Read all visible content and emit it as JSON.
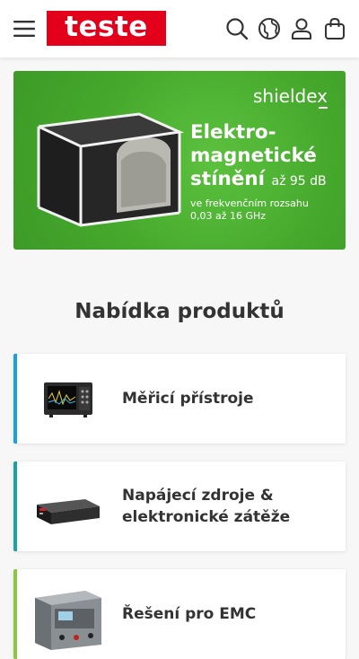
{
  "header": {
    "logo_text": "teste",
    "icons": [
      "menu-icon",
      "search-icon",
      "globe-icon",
      "user-icon",
      "shopping-bag-icon"
    ]
  },
  "banner": {
    "brand": "shieldex",
    "headline_line1": "Elektro-",
    "headline_line2": "magnetické",
    "headline_line3": "stínění",
    "headline_suffix": "až 95 dB",
    "sub_line1": "ve frekvenčním rozsahu",
    "sub_line2": "0,03 až 16 GHz",
    "colors": {
      "background": "#45a82c",
      "text": "#ffffff"
    }
  },
  "products": {
    "title": "Nabídka produktů",
    "items": [
      {
        "label": "Měřicí přístroje",
        "accent": "#1aa0d8",
        "image": "oscilloscope-image"
      },
      {
        "label": "Napájecí zdroje &",
        "label2": "elektronické zátěže",
        "accent": "#1aa3a3",
        "image": "power-supply-image"
      },
      {
        "label": "Řešení pro EMC",
        "accent": "#8cc63f",
        "image": "emc-tester-image"
      }
    ]
  },
  "colors": {
    "brand_red": "#e2001a",
    "page_bg": "#f7f7f7"
  }
}
